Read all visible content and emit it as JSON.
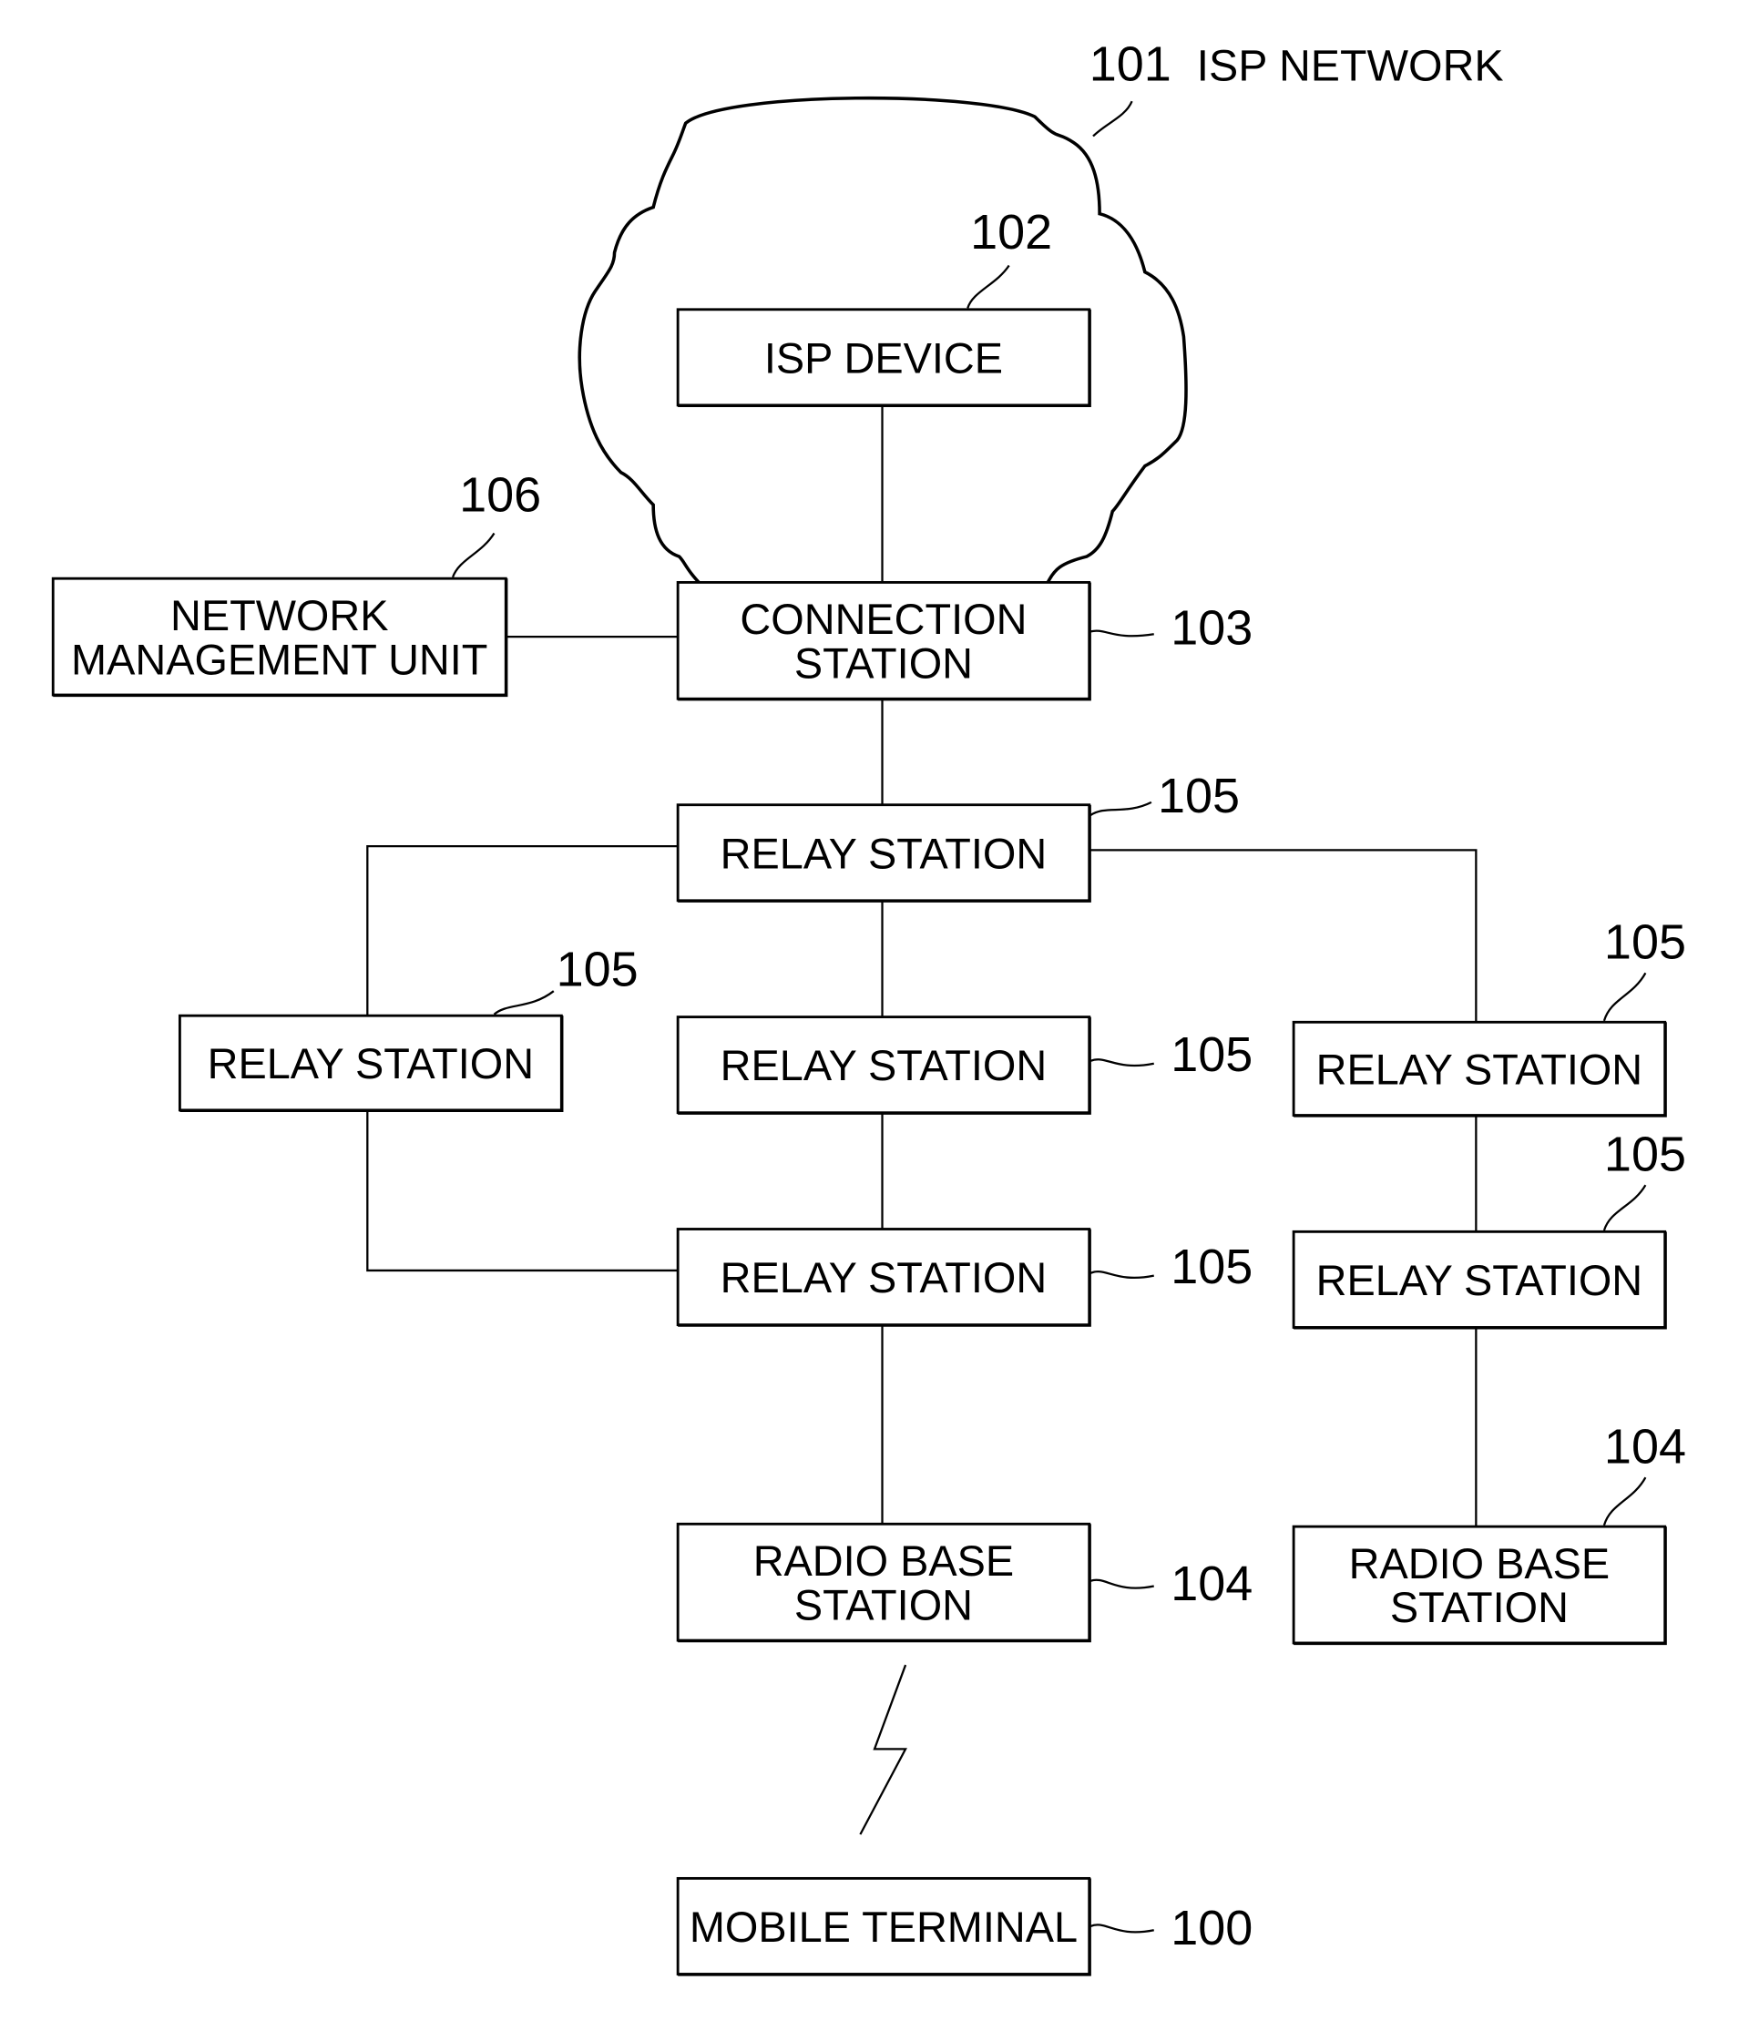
{
  "figure": {
    "network": {
      "ref": "101",
      "label": "ISP NETWORK"
    },
    "nodes": [
      {
        "id": "isp-device",
        "ref": "102",
        "lines": [
          "ISP DEVICE"
        ]
      },
      {
        "id": "network-management-unit",
        "ref": "106",
        "lines": [
          "NETWORK",
          "MANAGEMENT UNIT"
        ]
      },
      {
        "id": "connection-station",
        "ref": "103",
        "lines": [
          "CONNECTION",
          "STATION"
        ]
      },
      {
        "id": "relay-station-top",
        "ref": "105",
        "lines": [
          "RELAY STATION"
        ]
      },
      {
        "id": "relay-station-left",
        "ref": "105",
        "lines": [
          "RELAY STATION"
        ]
      },
      {
        "id": "relay-station-mid",
        "ref": "105",
        "lines": [
          "RELAY STATION"
        ]
      },
      {
        "id": "relay-station-right-upper",
        "ref": "105",
        "lines": [
          "RELAY STATION"
        ]
      },
      {
        "id": "relay-station-mid-lower",
        "ref": "105",
        "lines": [
          "RELAY STATION"
        ]
      },
      {
        "id": "relay-station-right-lower",
        "ref": "105",
        "lines": [
          "RELAY STATION"
        ]
      },
      {
        "id": "radio-base-station-left",
        "ref": "104",
        "lines": [
          "RADIO BASE",
          "STATION"
        ]
      },
      {
        "id": "radio-base-station-right",
        "ref": "104",
        "lines": [
          "RADIO BASE",
          "STATION"
        ]
      },
      {
        "id": "mobile-terminal",
        "ref": "100",
        "lines": [
          "MOBILE TERMINAL"
        ]
      }
    ],
    "connections": [
      [
        "isp-device",
        "connection-station"
      ],
      [
        "network-management-unit",
        "connection-station"
      ],
      [
        "connection-station",
        "relay-station-top"
      ],
      [
        "relay-station-top",
        "relay-station-left"
      ],
      [
        "relay-station-top",
        "relay-station-mid"
      ],
      [
        "relay-station-top",
        "relay-station-right-upper"
      ],
      [
        "relay-station-left",
        "relay-station-mid-lower"
      ],
      [
        "relay-station-mid",
        "relay-station-mid-lower"
      ],
      [
        "relay-station-right-upper",
        "relay-station-right-lower"
      ],
      [
        "relay-station-mid-lower",
        "radio-base-station-left"
      ],
      [
        "relay-station-right-lower",
        "radio-base-station-right"
      ]
    ],
    "wireless_link": [
      "radio-base-station-left",
      "mobile-terminal"
    ]
  }
}
